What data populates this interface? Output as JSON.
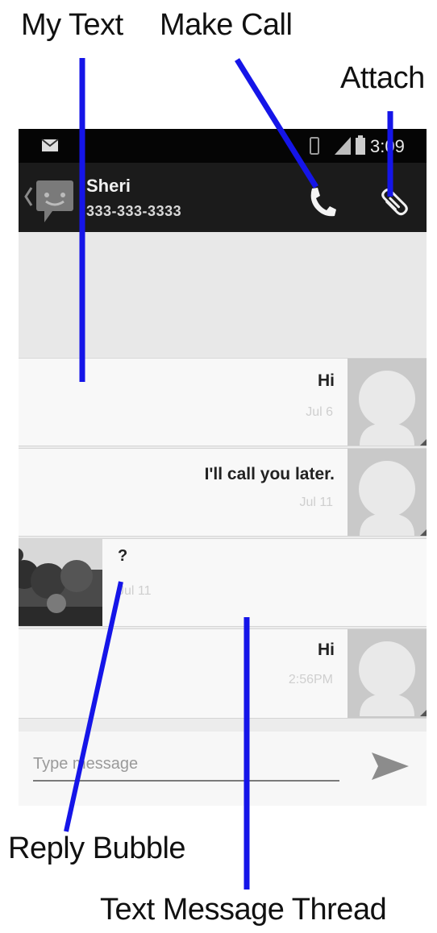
{
  "annotations": {
    "my_text": "My Text",
    "make_call": "Make Call",
    "attach": "Attach",
    "reply_bubble": "Reply Bubble",
    "text_message_thread": "Text Message Thread"
  },
  "status_bar": {
    "time": "3:09"
  },
  "action_bar": {
    "contact_name": "Sheri",
    "contact_number": "333-333-3333",
    "call_icon": "phone-icon",
    "attach_icon": "paperclip-icon"
  },
  "messages": [
    {
      "text": "Hi",
      "time": "Jul 6",
      "sender": "me"
    },
    {
      "text": "I'll call you later.",
      "time": "Jul 11",
      "sender": "me"
    },
    {
      "text": "?",
      "time": "Jul 11",
      "sender": "contact"
    },
    {
      "text": "Hi",
      "time": "2:56PM",
      "sender": "me"
    }
  ],
  "composer": {
    "placeholder": "Type message",
    "send_icon": "send-icon"
  },
  "colors": {
    "annotation_line": "#1515e8",
    "action_bar": "#1b1b1b",
    "status_bar": "#050505"
  }
}
